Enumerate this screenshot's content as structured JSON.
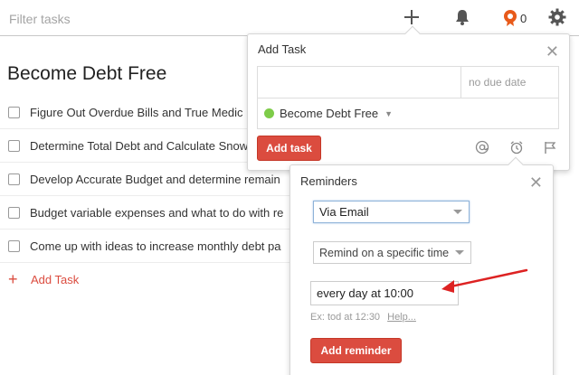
{
  "topbar": {
    "filter_placeholder": "Filter tasks",
    "karma_count": "0",
    "icons": [
      "add-icon",
      "bell-icon",
      "karma-icon",
      "gear-icon"
    ]
  },
  "project": {
    "title": "Become Debt Free",
    "tasks": [
      "Figure Out Overdue Bills and True Medic",
      "Determine Total Debt and Calculate Snow",
      "Develop Accurate Budget and determine remain",
      "Budget variable expenses and what to do with re",
      "Come up with ideas to increase monthly debt pa"
    ],
    "add_task_label": "Add Task"
  },
  "add_task_popover": {
    "title": "Add Task",
    "content_value": "",
    "due_placeholder": "no due date",
    "project_label": "Become Debt Free",
    "project_color": "#7ecc49",
    "submit_label": "Add task",
    "tools": [
      "at-icon",
      "alarm-clock-icon",
      "flag-icon"
    ]
  },
  "reminders_popover": {
    "title": "Reminders",
    "method_value": "Via Email",
    "type_value": "Remind on a specific time",
    "due_value": "every day at 10:00",
    "hint_text": "Ex: tod at 12:30",
    "help_label": "Help...",
    "submit_label": "Add reminder"
  },
  "colors": {
    "accent_red": "#db4c3f",
    "annotation_red": "#dd2222"
  }
}
